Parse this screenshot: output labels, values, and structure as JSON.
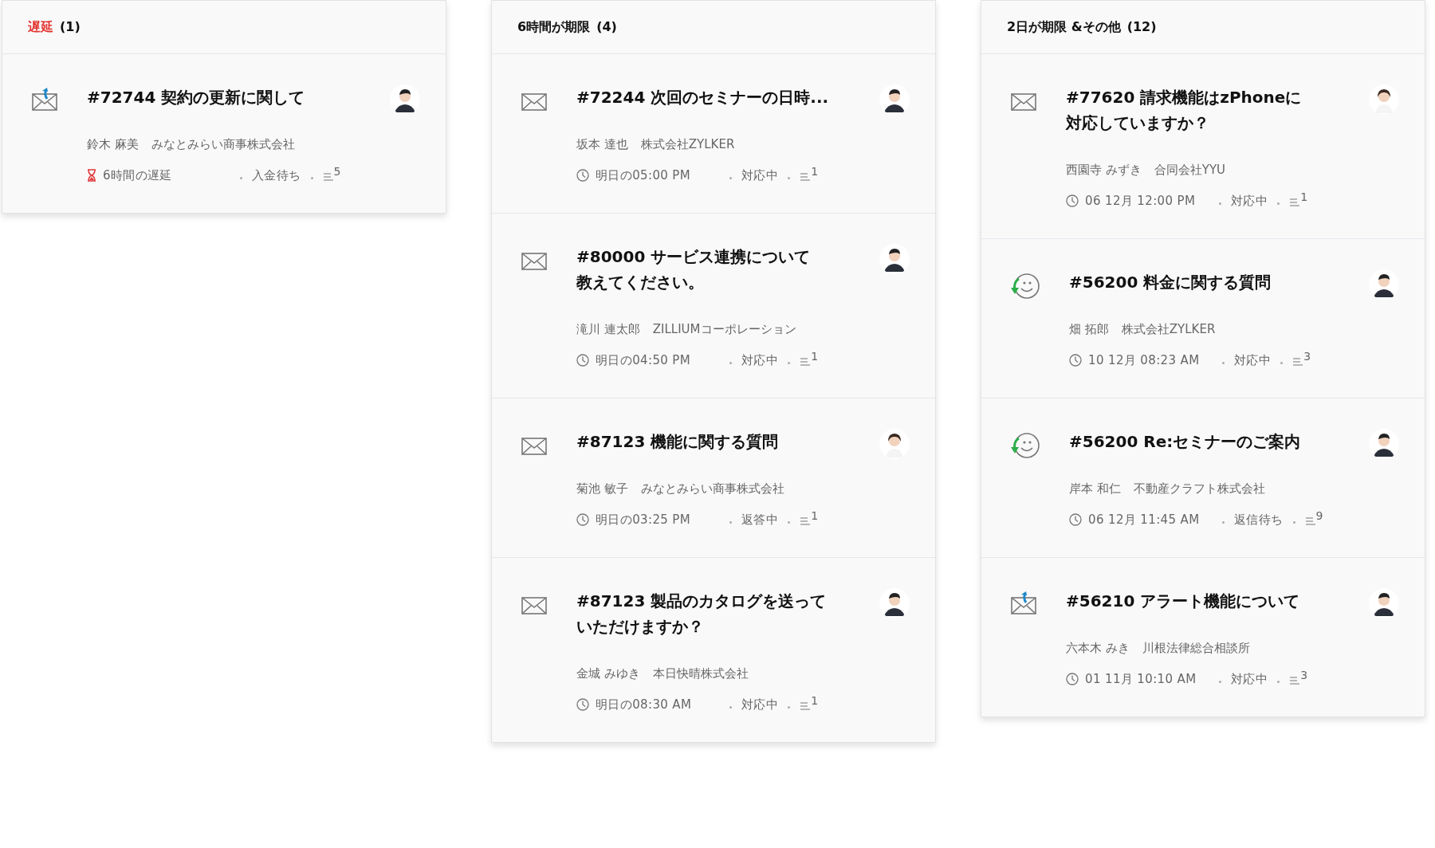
{
  "columns": [
    {
      "header": {
        "title": "遅延",
        "count": "(1)",
        "overdue": true
      },
      "tickets": [
        {
          "kind": "reply",
          "title_lines": [
            "#72744 契約の更新に関して"
          ],
          "avatar": {
            "kind": "male"
          },
          "contact": "鈴木 麻美",
          "company": "みなとみらい商事株式会社",
          "due": {
            "kind": "overdue",
            "text": "6時間の遅延"
          },
          "status": "入金待ち",
          "threads": "5"
        }
      ]
    },
    {
      "header": {
        "title": "6時間が期限",
        "count": "(4)",
        "overdue": false
      },
      "tickets": [
        {
          "kind": "mail",
          "title_lines": [
            "#72244 次回のセミナーの日時..."
          ],
          "avatar": {
            "kind": "male"
          },
          "contact": "坂本 達也",
          "company": "株式会社ZYLKER",
          "due": {
            "kind": "clock",
            "text": "明日の05:00 PM"
          },
          "status": "対応中",
          "threads": "1"
        },
        {
          "kind": "mail",
          "title_lines": [
            "#80000 サービス連携について",
            "教えてください。"
          ],
          "avatar": {
            "kind": "male"
          },
          "contact": "滝川 連太郎",
          "company": "ZILLIUMコーポレーション",
          "due": {
            "kind": "clock",
            "text": "明日の04:50 PM"
          },
          "status": "対応中",
          "threads": "1"
        },
        {
          "kind": "mail",
          "title_lines": [
            "#87123 機能に関する質問"
          ],
          "avatar": {
            "kind": "female"
          },
          "contact": "菊池 敏子",
          "company": "みなとみらい商事株式会社",
          "due": {
            "kind": "clock",
            "text": "明日の03:25 PM"
          },
          "status": "返答中",
          "threads": "1"
        },
        {
          "kind": "mail",
          "title_lines": [
            "#87123 製品のカタログを送って",
            "いただけますか？"
          ],
          "avatar": {
            "kind": "male"
          },
          "contact": "金城 みゆき",
          "company": "本日快晴株式会社",
          "due": {
            "kind": "clock",
            "text": "明日の08:30 AM"
          },
          "status": "対応中",
          "threads": "1"
        }
      ]
    },
    {
      "header": {
        "title": "2日が期限 &その他",
        "count": "(12)",
        "overdue": false
      },
      "tickets": [
        {
          "kind": "mail",
          "title_lines": [
            "#77620 請求機能はzPhoneに",
            "対応していますか？"
          ],
          "avatar": {
            "kind": "female"
          },
          "contact": "西園寺 みずき",
          "company": "合同会社YYU",
          "due": {
            "kind": "clock",
            "text": "06 12月 12:00 PM"
          },
          "status": "対応中",
          "threads": "1"
        },
        {
          "kind": "customer",
          "title_lines": [
            "#56200 料金に関する質問"
          ],
          "avatar": {
            "kind": "male"
          },
          "contact": "畑 拓郎",
          "company": "株式会社ZYLKER",
          "due": {
            "kind": "clock",
            "text": "10 12月 08:23 AM"
          },
          "status": "対応中",
          "threads": "3"
        },
        {
          "kind": "customer",
          "title_lines": [
            "#56200 Re:セミナーのご案内"
          ],
          "avatar": {
            "kind": "male"
          },
          "contact": "岸本 和仁",
          "company": "不動産クラフト株式会社",
          "due": {
            "kind": "clock",
            "text": "06 12月 11:45 AM"
          },
          "status": "返信待ち",
          "threads": "9"
        },
        {
          "kind": "reply",
          "title_lines": [
            "#56210 アラート機能について"
          ],
          "avatar": {
            "kind": "male"
          },
          "contact": "六本木 みき",
          "company": "川根法律総合相談所",
          "due": {
            "kind": "clock",
            "text": "01 11月 10:10 AM"
          },
          "status": "対応中",
          "threads": "3"
        }
      ]
    }
  ]
}
